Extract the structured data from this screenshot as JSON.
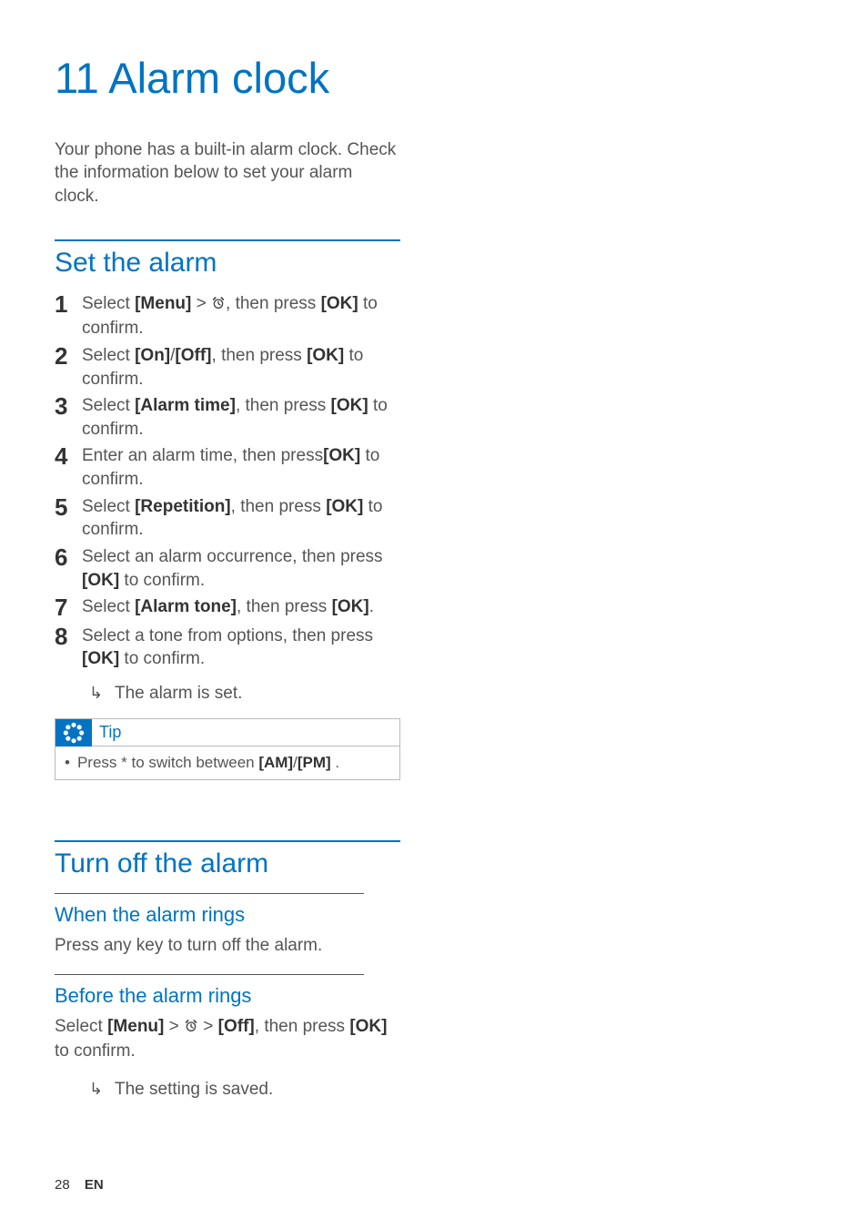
{
  "chapter": {
    "number": "11",
    "title": "Alarm clock"
  },
  "intro": "Your phone has a built-in alarm clock. Check the information below to set your alarm clock.",
  "section1": {
    "heading": "Set the alarm",
    "steps": [
      {
        "num": "1",
        "segs": [
          "Select ",
          "[Menu]",
          " > ",
          "@ICON",
          ", then press ",
          "[OK]",
          " to confirm."
        ]
      },
      {
        "num": "2",
        "segs": [
          "Select ",
          "[On]",
          "/",
          "[Off]",
          ", then press ",
          "[OK]",
          " to confirm."
        ]
      },
      {
        "num": "3",
        "segs": [
          "Select ",
          "[Alarm time]",
          ", then press ",
          "[OK]",
          " to confirm."
        ]
      },
      {
        "num": "4",
        "segs": [
          "Enter an alarm time, then press",
          "[OK]",
          " to confirm."
        ]
      },
      {
        "num": "5",
        "segs": [
          "Select ",
          "[Repetition]",
          ", then press ",
          "[OK]",
          " to confirm."
        ]
      },
      {
        "num": "6",
        "segs": [
          "Select an alarm occurrence, then press ",
          "[OK]",
          " to confirm."
        ]
      },
      {
        "num": "7",
        "segs": [
          "Select ",
          "[Alarm tone]",
          ", then press ",
          "[OK]",
          "."
        ]
      },
      {
        "num": "8",
        "segs": [
          "Select a tone from options, then press ",
          "[OK]",
          " to confirm."
        ]
      }
    ],
    "result": "The alarm is set.",
    "tip": {
      "label": "Tip",
      "bodySegs": [
        "Press * to switch between ",
        "[AM]",
        "/",
        "[PM]",
        " ."
      ]
    }
  },
  "section2": {
    "heading": "Turn off the alarm",
    "sub1": {
      "heading": "When the alarm rings",
      "body": "Press any key to turn off the alarm."
    },
    "sub2": {
      "heading": "Before the alarm rings",
      "bodySegs": [
        "Select ",
        "[Menu]",
        " > ",
        "@ICON",
        " > ",
        "[Off]",
        ", then press ",
        "[OK]",
        " to confirm."
      ],
      "result": "The setting is saved."
    }
  },
  "footer": {
    "page": "28",
    "lang": "EN"
  }
}
